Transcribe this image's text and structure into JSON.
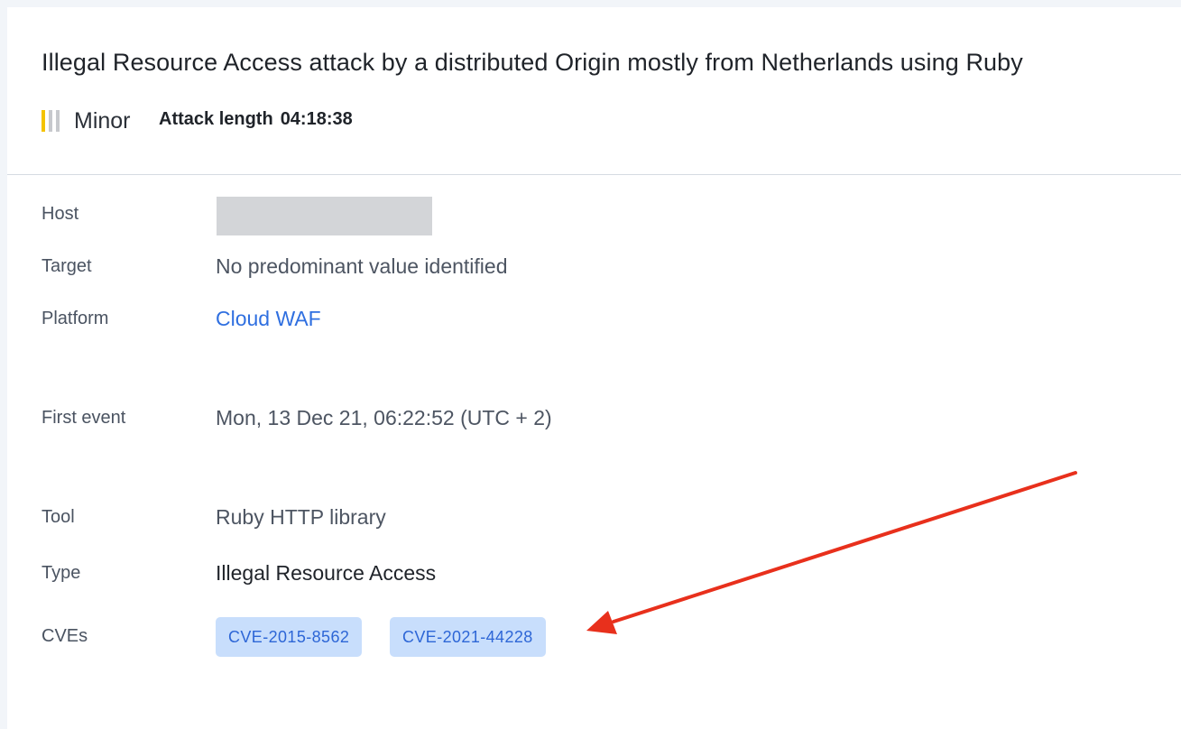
{
  "title": "Illegal Resource Access attack by a distributed Origin mostly from Netherlands using Ruby",
  "severity": {
    "label": "Minor",
    "icon": "severity-bars-icon",
    "color": "#f4c300"
  },
  "attack_length": {
    "label": "Attack length",
    "value": "04:18:38"
  },
  "details": [
    {
      "label": "Host",
      "value": ""
    },
    {
      "label": "Target",
      "value": "No predominant value identified"
    },
    {
      "label": "Platform",
      "value": "Cloud WAF"
    },
    {
      "label": "First event",
      "value": "Mon, 13 Dec 21, 06:22:52 (UTC + 2)"
    },
    {
      "label": "Tool",
      "value": "Ruby HTTP library"
    },
    {
      "label": "Type",
      "value": "Illegal Resource Access"
    },
    {
      "label": "CVEs",
      "tags": [
        "CVE-2015-8562",
        "CVE-2021-44228"
      ]
    }
  ],
  "annotation": {
    "arrow_color": "#e8301c"
  },
  "colors": {
    "link": "#2f6fe0",
    "tag_bg": "#c8defc",
    "tag_text": "#2d66d6"
  }
}
